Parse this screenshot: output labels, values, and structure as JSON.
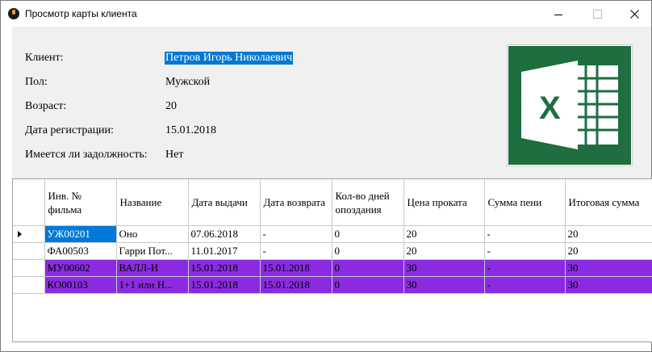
{
  "window": {
    "title": "Просмотр карты клиента"
  },
  "client": {
    "name_label": "Клиент:",
    "name": "Петров Игорь Николаевич",
    "gender_label": "Пол:",
    "gender": "Мужской",
    "age_label": "Возраст:",
    "age": "20",
    "reg_label": "Дата регистрации:",
    "reg_date": "15.01.2018",
    "debt_label": "Имеется ли задолжность:",
    "debt": "Нет"
  },
  "export": {
    "icon": "excel-icon",
    "color": "#1e6e40"
  },
  "table": {
    "columns": [
      "Инв. № фильма",
      "Название",
      "Дата выдачи",
      "Дата возврата",
      "Кол-во дней опоздания",
      "Цена проката",
      "Сумма пени",
      "Итоговая сумма"
    ],
    "rows": [
      [
        "УЖ00201",
        "Оно",
        "07.06.2018",
        "-",
        "0",
        "20",
        "-",
        "20"
      ],
      [
        "ФА00503",
        "Гарри Пот...",
        "11.01.2017",
        "-",
        "0",
        "20",
        "-",
        "20"
      ],
      [
        "МУ00602",
        "ВАЛЛ-И",
        "15.01.2018",
        "15.01.2018",
        "0",
        "30",
        "-",
        "30"
      ],
      [
        "КО00103",
        "1+1 или Н...",
        "15.01.2018",
        "15.01.2018",
        "0",
        "30",
        "-",
        "30"
      ]
    ],
    "highlight_color": "#8a2be2",
    "selection_color": "#0078d7"
  }
}
